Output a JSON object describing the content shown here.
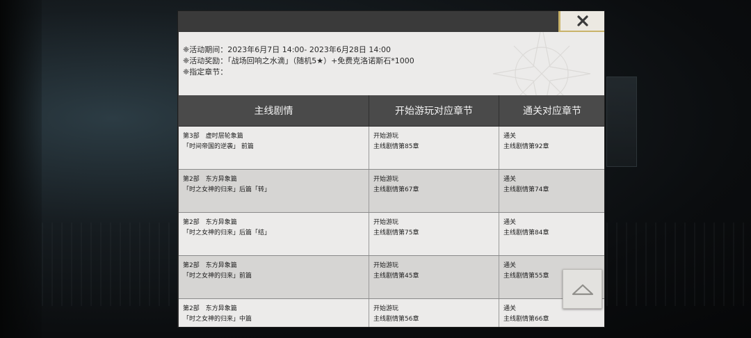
{
  "dialog": {
    "close_label": "×",
    "info": {
      "period": "❈活动期间：2023年6月7日 14:00- 2023年6月28日 14:00",
      "reward": "❈活动奖励：「战场回响之水滴」（随机5★）+免费克洛诺斯石*1000",
      "chapter": "❈指定章节："
    },
    "table": {
      "headers": [
        "主线剧情",
        "开始游玩对应章节",
        "通关对应章节"
      ],
      "rows": [
        {
          "story_1": "第3部　虚时层轮象篇",
          "story_2": "「时间帝国的逆袭」 前篇",
          "start_1": "开始游玩",
          "start_2": "主线剧情第85章",
          "clear_1": "通关",
          "clear_2": "主线剧情第92章"
        },
        {
          "story_1": "第2部　东方异象篇",
          "story_2": "「时之女神的归来」后篇「转」",
          "start_1": "开始游玩",
          "start_2": "主线剧情第67章",
          "clear_1": "通关",
          "clear_2": "主线剧情第74章"
        },
        {
          "story_1": "第2部　东方异象篇",
          "story_2": "「时之女神的归来」后篇「结」",
          "start_1": "开始游玩",
          "start_2": "主线剧情第75章",
          "clear_1": "通关",
          "clear_2": "主线剧情第84章"
        },
        {
          "story_1": "第2部　东方异象篇",
          "story_2": "「时之女神的归来」前篇",
          "start_1": "开始游玩",
          "start_2": "主线剧情第45章",
          "clear_1": "通关",
          "clear_2": "主线剧情第55章"
        },
        {
          "story_1": "第2部　东方异象篇",
          "story_2": "「时之女神的归来」中篇",
          "start_1": "开始游玩",
          "start_2": "主线剧情第56章",
          "clear_1": "通关",
          "clear_2": "主线剧情第66章"
        }
      ]
    }
  },
  "icons": {
    "close": "close-icon",
    "scroll_top": "chevron-up-icon"
  },
  "colors": {
    "accent_gold": "#c9b36a",
    "header_bg": "#4a4a4a",
    "row_light": "#ecebea",
    "row_dark": "#d6d5d3"
  }
}
